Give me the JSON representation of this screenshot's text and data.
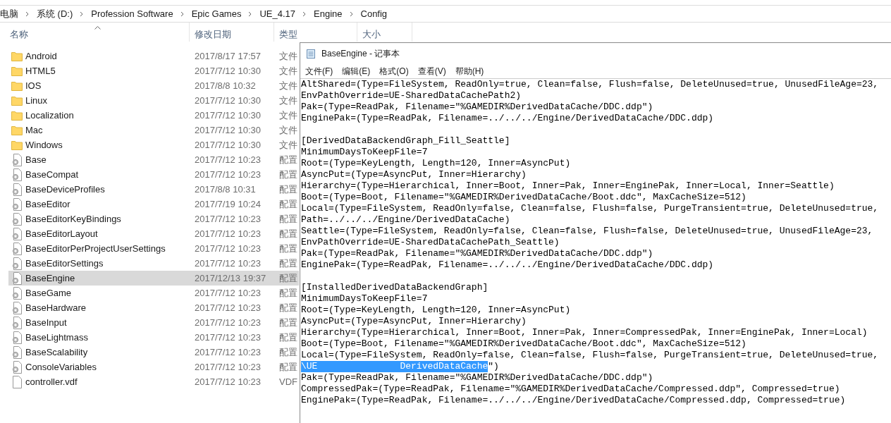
{
  "breadcrumb": [
    "电脑",
    "系统 (D:)",
    "Profession Software",
    "Epic Games",
    "UE_4.17",
    "Engine",
    "Config"
  ],
  "columns": [
    "名称",
    "修改日期",
    "类型",
    "大小"
  ],
  "files": [
    {
      "name": "Android",
      "date": "2017/8/17 17:57",
      "type": "文件",
      "kind": "folder",
      "selected": false
    },
    {
      "name": "HTML5",
      "date": "2017/7/12 10:30",
      "type": "文件",
      "kind": "folder",
      "selected": false
    },
    {
      "name": "IOS",
      "date": "2017/8/8 10:32",
      "type": "文件",
      "kind": "folder",
      "selected": false
    },
    {
      "name": "Linux",
      "date": "2017/7/12 10:30",
      "type": "文件",
      "kind": "folder",
      "selected": false
    },
    {
      "name": "Localization",
      "date": "2017/7/12 10:30",
      "type": "文件",
      "kind": "folder",
      "selected": false
    },
    {
      "name": "Mac",
      "date": "2017/7/12 10:30",
      "type": "文件",
      "kind": "folder",
      "selected": false
    },
    {
      "name": "Windows",
      "date": "2017/7/12 10:30",
      "type": "文件",
      "kind": "folder",
      "selected": false
    },
    {
      "name": "Base",
      "date": "2017/7/12 10:23",
      "type": "配置",
      "kind": "config",
      "selected": false
    },
    {
      "name": "BaseCompat",
      "date": "2017/7/12 10:23",
      "type": "配置",
      "kind": "config",
      "selected": false
    },
    {
      "name": "BaseDeviceProfiles",
      "date": "2017/8/8 10:31",
      "type": "配置",
      "kind": "config",
      "selected": false
    },
    {
      "name": "BaseEditor",
      "date": "2017/7/19 10:24",
      "type": "配置",
      "kind": "config",
      "selected": false
    },
    {
      "name": "BaseEditorKeyBindings",
      "date": "2017/7/12 10:23",
      "type": "配置",
      "kind": "config",
      "selected": false
    },
    {
      "name": "BaseEditorLayout",
      "date": "2017/7/12 10:23",
      "type": "配置",
      "kind": "config",
      "selected": false
    },
    {
      "name": "BaseEditorPerProjectUserSettings",
      "date": "2017/7/12 10:23",
      "type": "配置",
      "kind": "config",
      "selected": false
    },
    {
      "name": "BaseEditorSettings",
      "date": "2017/7/12 10:23",
      "type": "配置",
      "kind": "config",
      "selected": false
    },
    {
      "name": "BaseEngine",
      "date": "2017/12/13 19:37",
      "type": "配置",
      "kind": "config",
      "selected": true
    },
    {
      "name": "BaseGame",
      "date": "2017/7/12 10:23",
      "type": "配置",
      "kind": "config",
      "selected": false
    },
    {
      "name": "BaseHardware",
      "date": "2017/7/12 10:23",
      "type": "配置",
      "kind": "config",
      "selected": false
    },
    {
      "name": "BaseInput",
      "date": "2017/7/12 10:23",
      "type": "配置",
      "kind": "config",
      "selected": false
    },
    {
      "name": "BaseLightmass",
      "date": "2017/7/12 10:23",
      "type": "配置",
      "kind": "config",
      "selected": false
    },
    {
      "name": "BaseScalability",
      "date": "2017/7/12 10:23",
      "type": "配置",
      "kind": "config",
      "selected": false
    },
    {
      "name": "ConsoleVariables",
      "date": "2017/7/12 10:23",
      "type": "配置",
      "kind": "config",
      "selected": false
    },
    {
      "name": "controller.vdf",
      "date": "2017/7/12 10:23",
      "type": "VDF",
      "kind": "file",
      "selected": false
    }
  ],
  "notepad": {
    "title": "BaseEngine - 记事本",
    "menu": [
      "文件(F)",
      "编辑(E)",
      "格式(O)",
      "查看(V)",
      "帮助(H)"
    ],
    "sections": [
      {
        "lines": [
          {
            "text": "AltShared=(Type=FileSystem, ReadOnly=true, Clean=false, Flush=false, DeleteUnused=true, UnusedFileAge=23,"
          },
          {
            "text": "EnvPathOverride=UE-SharedDataCachePath2)"
          },
          {
            "text": "Pak=(Type=ReadPak, Filename=\"%GAMEDIR%DerivedDataCache/DDC.ddp\")"
          },
          {
            "text": "EnginePak=(Type=ReadPak, Filename=../../../Engine/DerivedDataCache/DDC.ddp)"
          }
        ]
      },
      {
        "lines": [
          {
            "text": "[DerivedDataBackendGraph_Fill_Seattle]"
          },
          {
            "text": "MinimumDaysToKeepFile=7"
          },
          {
            "text": "Root=(Type=KeyLength, Length=120, Inner=AsyncPut)"
          },
          {
            "text": "AsyncPut=(Type=AsyncPut, Inner=Hierarchy)"
          },
          {
            "text": "Hierarchy=(Type=Hierarchical, Inner=Boot, Inner=Pak, Inner=EnginePak, Inner=Local, Inner=Seattle)"
          },
          {
            "text": "Boot=(Type=Boot, Filename=\"%GAMEDIR%DerivedDataCache/Boot.ddc\", MaxCacheSize=512)"
          },
          {
            "text": "Local=(Type=FileSystem, ReadOnly=false, Clean=false, Flush=false, PurgeTransient=true, DeleteUnused=true,"
          },
          {
            "text": "Path=../../../Engine/DerivedDataCache)"
          },
          {
            "text": "Seattle=(Type=FileSystem, ReadOnly=false, Clean=false, Flush=false, DeleteUnused=true, UnusedFileAge=23,"
          },
          {
            "text": "EnvPathOverride=UE-SharedDataCachePath_Seattle)"
          },
          {
            "text": "Pak=(Type=ReadPak, Filename=\"%GAMEDIR%DerivedDataCache/DDC.ddp\")"
          },
          {
            "text": "EnginePak=(Type=ReadPak, Filename=../../../Engine/DerivedDataCache/DDC.ddp)"
          }
        ]
      },
      {
        "lines": [
          {
            "text": "[InstalledDerivedDataBackendGraph]"
          },
          {
            "text": "MinimumDaysToKeepFile=7"
          },
          {
            "text": "Root=(Type=KeyLength, Length=120, Inner=AsyncPut)"
          },
          {
            "text": "AsyncPut=(Type=AsyncPut, Inner=Hierarchy)"
          },
          {
            "text": "Hierarchy=(Type=Hierarchical, Inner=Boot, Inner=Pak, Inner=CompressedPak, Inner=EnginePak, Inner=Local)"
          },
          {
            "text": "Boot=(Type=Boot, Filename=\"%GAMEDIR%DerivedDataCache/Boot.ddc\", MaxCacheSize=512)"
          },
          {
            "text": "Local=(Type=FileSystem, ReadOnly=false, Clean=false, Flush=false, PurgeTransient=true, DeleteUnused=true,"
          },
          {
            "selection": "\\UE               DerivedDataCache",
            "text": "\")"
          },
          {
            "text": "Pak=(Type=ReadPak, Filename=\"%GAMEDIR%DerivedDataCache/DDC.ddp\")"
          },
          {
            "text": "CompressedPak=(Type=ReadPak, Filename=\"%GAMEDIR%DerivedDataCache/Compressed.ddp\", Compressed=true)"
          },
          {
            "text": "EnginePak=(Type=ReadPak, Filename=../../../Engine/DerivedDataCache/Compressed.ddp, Compressed=true)"
          }
        ]
      }
    ]
  }
}
